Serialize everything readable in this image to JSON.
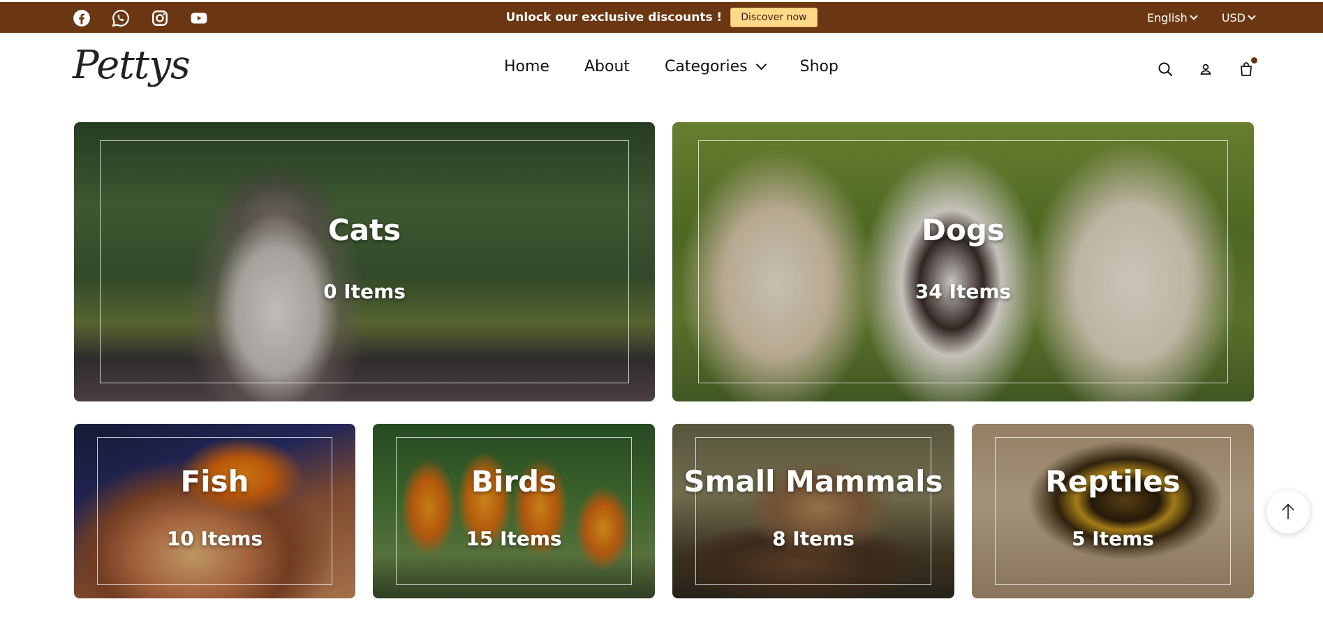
{
  "topbar": {
    "social": [
      {
        "icon": "facebook-icon"
      },
      {
        "icon": "whatsapp-icon"
      },
      {
        "icon": "instagram-icon"
      },
      {
        "icon": "youtube-icon"
      }
    ],
    "promo_text": "Unlock our exclusive discounts !",
    "promo_button": "Discover now",
    "language": "English",
    "currency": "USD",
    "colors": {
      "background": "#6b3712",
      "button": "#ffd98a"
    }
  },
  "header": {
    "logo": "Pettys",
    "nav": {
      "home": "Home",
      "about": "About",
      "categories": "Categories",
      "shop": "Shop"
    },
    "actions": [
      {
        "icon": "search-icon"
      },
      {
        "icon": "user-icon"
      },
      {
        "icon": "shopping-bag-icon"
      }
    ]
  },
  "categories": {
    "cats": {
      "title": "Cats",
      "count": "0 Items"
    },
    "dogs": {
      "title": "Dogs",
      "count": "34 Items"
    },
    "fish": {
      "title": "Fish",
      "count": "10 Items"
    },
    "birds": {
      "title": "Birds",
      "count": "15 Items"
    },
    "small_mammals": {
      "title": "Small Mammals",
      "count": "8 Items"
    },
    "reptiles": {
      "title": "Reptiles",
      "count": "5 Items"
    }
  },
  "scroll_top": {
    "icon": "arrow-up-icon"
  }
}
